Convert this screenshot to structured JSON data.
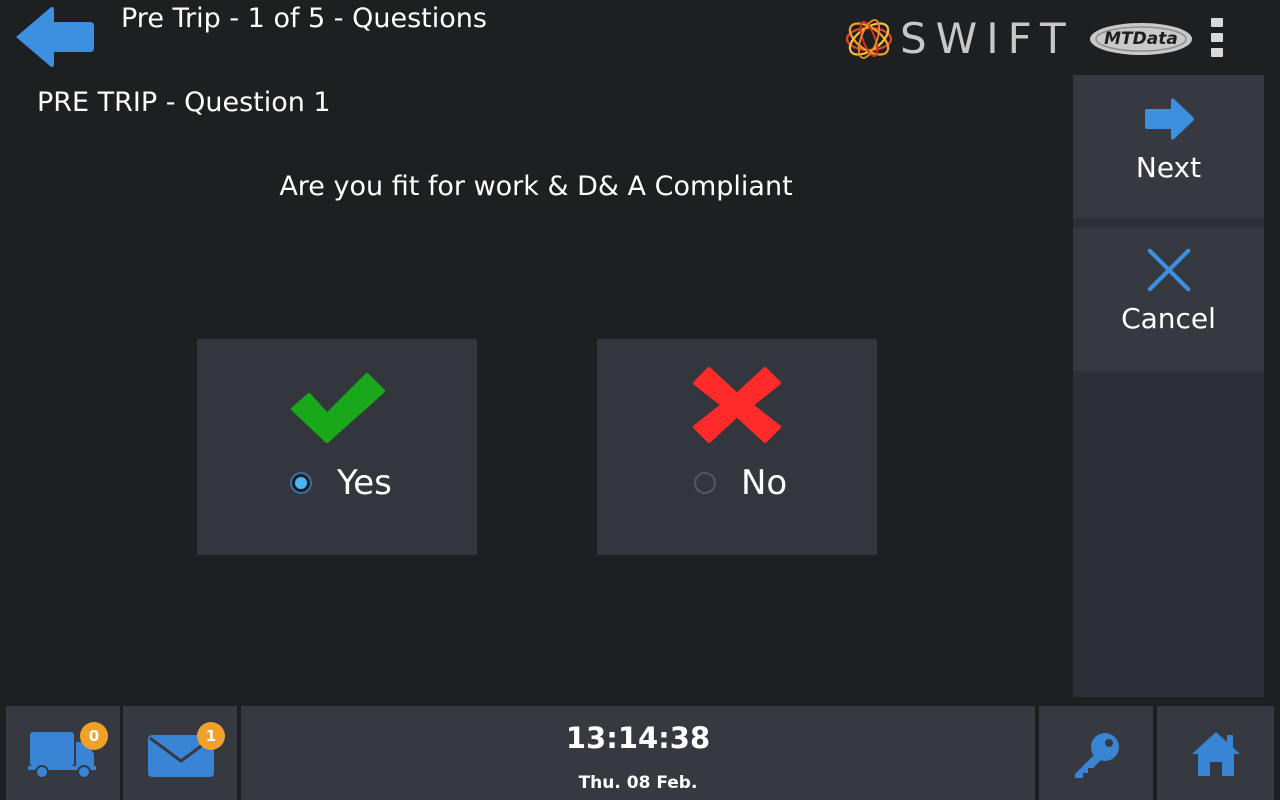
{
  "header": {
    "title": "Pre Trip - 1 of 5 - Questions",
    "brand_swift": "SWIFT",
    "brand_mtdata": "MTData",
    "back_icon": "back-arrow-icon",
    "menu_icon": "kebab-menu-icon"
  },
  "question": {
    "heading": "PRE TRIP - Question 1",
    "text": "Are you fit for work & D& A Compliant"
  },
  "answers": [
    {
      "label": "Yes",
      "selected": true,
      "icon": "checkmark-icon",
      "icon_color": "#18a81a"
    },
    {
      "label": "No",
      "selected": false,
      "icon": "cross-icon",
      "icon_color": "#ff2a2a"
    }
  ],
  "side_panel": {
    "next_label": "Next",
    "cancel_label": "Cancel",
    "accent_color": "#3d8fe0"
  },
  "footer": {
    "truck_badge": "0",
    "mail_badge": "1",
    "time": "13:14:38",
    "date": "Thu. 08 Feb.",
    "icon_color": "#3a84d6",
    "badge_color": "#f0a12a"
  }
}
